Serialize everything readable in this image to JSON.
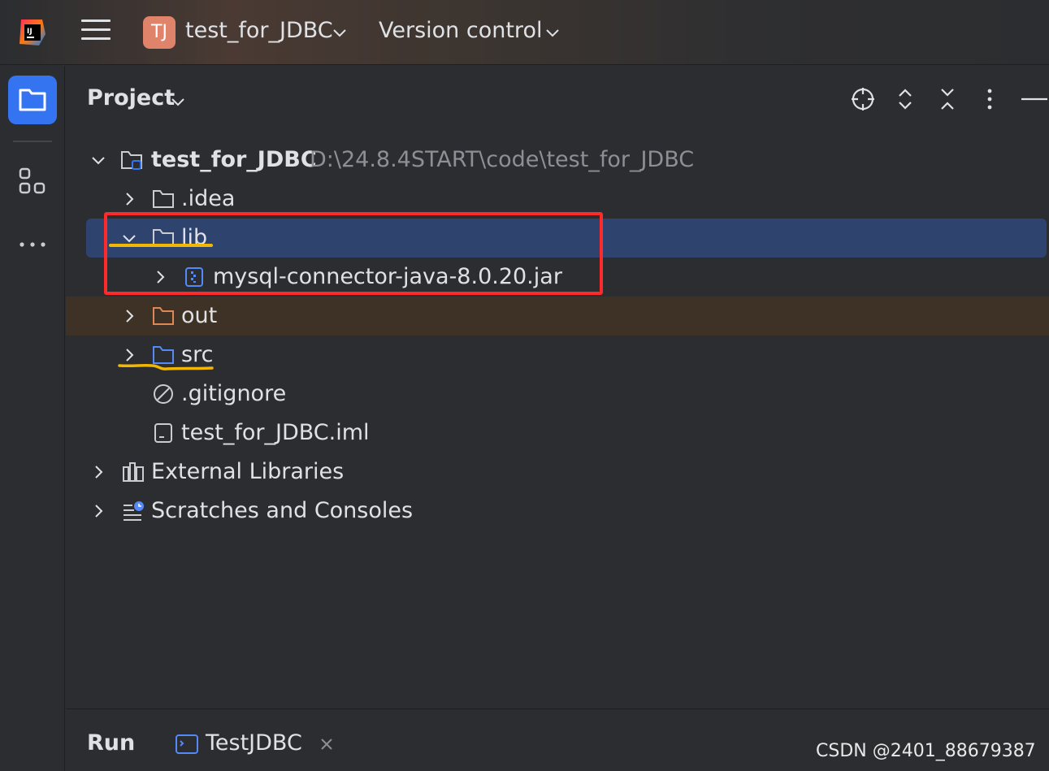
{
  "titlebar": {
    "app_logo_text": "IJ",
    "project_badge": "TJ",
    "project_name": "test_for_JDBC",
    "version_control_label": "Version control"
  },
  "panel": {
    "title": "Project"
  },
  "tree": {
    "root_name": "test_for_JDBC",
    "root_path": "D:\\24.8.4START\\code\\test_for_JDBC",
    "items": [
      {
        "label": ".idea"
      },
      {
        "label": "lib"
      },
      {
        "label": "mysql-connector-java-8.0.20.jar"
      },
      {
        "label": "out"
      },
      {
        "label": "src"
      },
      {
        "label": ".gitignore"
      },
      {
        "label": "test_for_JDBC.iml"
      },
      {
        "label": "External Libraries"
      },
      {
        "label": "Scratches and Consoles"
      }
    ]
  },
  "bottombar": {
    "run_label": "Run",
    "run_tab": "TestJDBC"
  },
  "watermark": "CSDN @2401_88679387",
  "colors": {
    "accent": "#3574f0",
    "selection": "#2e436e",
    "excluded_row": "#3e3226",
    "annotation_box": "#ff2a2a",
    "annotation_underline": "#f2b705"
  }
}
